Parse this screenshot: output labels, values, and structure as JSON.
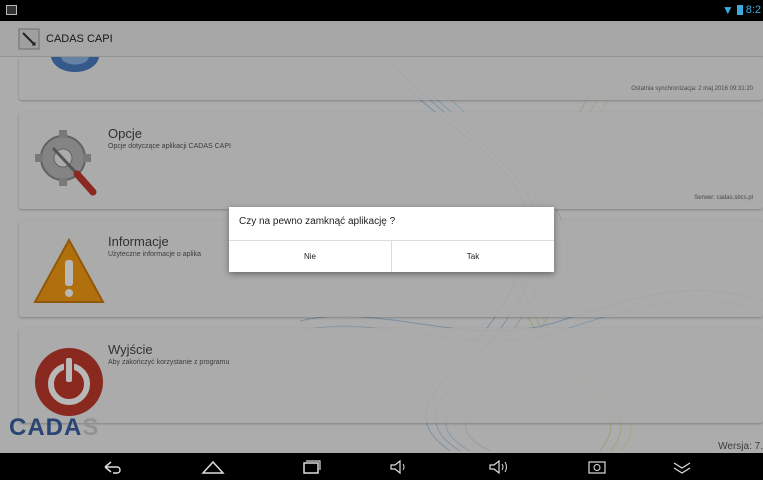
{
  "status": {
    "time": "8:2"
  },
  "app": {
    "title": "CADAS CAPI"
  },
  "cards": [
    {
      "title": "",
      "subtitle": "",
      "meta": "Ostatnia synchronizacja: 2 maj 2016 09:31:20"
    },
    {
      "title": "Opcje",
      "subtitle": "Opcje dotyczące aplikacji CADAS CAPI",
      "meta": "Serwer: cadas.sbcs.pl"
    },
    {
      "title": "Informacje",
      "subtitle": "Użyteczne informacje o aplika",
      "meta": ""
    },
    {
      "title": "Wyjście",
      "subtitle": "Aby zakończyć korzystanie z programu",
      "meta": ""
    }
  ],
  "dialog": {
    "message": "Czy na pewno zamknąć aplikację ?",
    "no_label": "Nie",
    "yes_label": "Tak"
  },
  "footer": {
    "logo_main": "CADA",
    "logo_tail": "S",
    "version": "Wersja: 7."
  },
  "colors": {
    "accent": "#39a9e0",
    "logo": "#3b5fa0",
    "warning": "#f39c12",
    "exit": "#c0392b"
  }
}
